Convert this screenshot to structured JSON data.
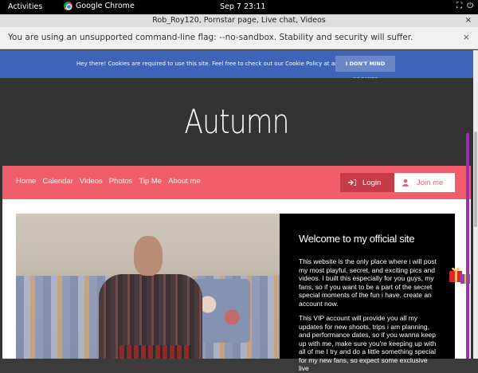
{
  "system_bar": {
    "activities": "Activities",
    "app_name": "Google Chrome",
    "clock": "Sep 7  23:11"
  },
  "window": {
    "title": "Rob_Roy120, Pornstar page, Live chat, Videos",
    "close": "×"
  },
  "infobar": {
    "message": "You are using an unsupported command-line flag: --no-sandbox. Stability and security will suffer.",
    "close": "×"
  },
  "cookie": {
    "message": "Hey there! Cookies are required to use this site. Feel free to check out our Cookie Policy at any time.",
    "button": "I DON'T MIND COOKIES"
  },
  "site": {
    "title": "Autumn",
    "nav": [
      "Home",
      "Calendar",
      "Videos",
      "Photos",
      "Tip Me",
      "About me"
    ],
    "login": "Login",
    "join": "Join me",
    "welcome_heading": "Welcome to my official site",
    "para1": "This website is the only place where i will post my most playful, secret, and exciting pics and videos. I built this especially for you guys, my fans, so if you want to be a part of the secret special moments of the fun i have, create an account now.",
    "para2": "This VIP account will provide you all my updates for new shoots, trips i am planning, and performance dates, so if you wanna keep up with me, make sure you're keeping up with all of me I try and do a little something special for my new fans, so expect some exclusive live"
  },
  "colors": {
    "accent": "#f15d6b",
    "cookie_bar": "#3d64b7",
    "dark": "#333333"
  }
}
